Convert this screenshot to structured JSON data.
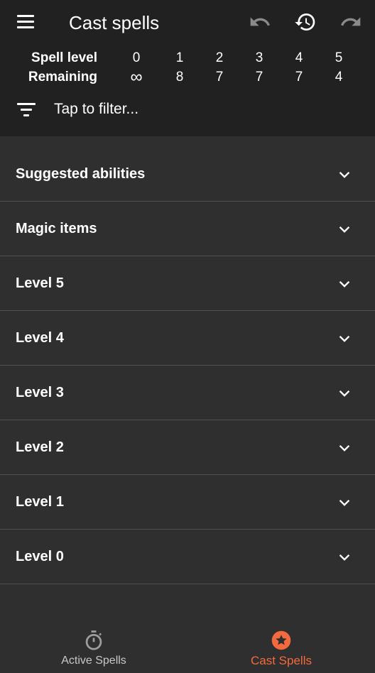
{
  "app": {
    "title": "Cast spells",
    "icons": {
      "menu": "menu-icon",
      "undo": "undo-icon",
      "history": "history-icon",
      "redo": "redo-icon"
    }
  },
  "spell_slots": {
    "level_label": "Spell level",
    "remaining_label": "Remaining",
    "levels": [
      "0",
      "1",
      "2",
      "3",
      "4",
      "5"
    ],
    "remaining": [
      "∞",
      "8",
      "7",
      "7",
      "7",
      "4"
    ]
  },
  "filter": {
    "icon": "filter-icon",
    "placeholder": "Tap to filter..."
  },
  "sections": [
    {
      "label": "Suggested abilities"
    },
    {
      "label": "Magic items"
    },
    {
      "label": "Level 5"
    },
    {
      "label": "Level 4"
    },
    {
      "label": "Level 3"
    },
    {
      "label": "Level 2"
    },
    {
      "label": "Level 1"
    },
    {
      "label": "Level 0"
    }
  ],
  "bottom_nav": {
    "tabs": [
      {
        "label": "Active Spells",
        "icon": "stopwatch-icon",
        "active": false
      },
      {
        "label": "Cast Spells",
        "icon": "star-icon",
        "active": true
      }
    ]
  },
  "colors": {
    "header_bg": "#212121",
    "body_bg": "#2f2f2f",
    "accent": "#f26a3d",
    "inactive_icon": "#9e9e9e",
    "divider": "#505050"
  }
}
